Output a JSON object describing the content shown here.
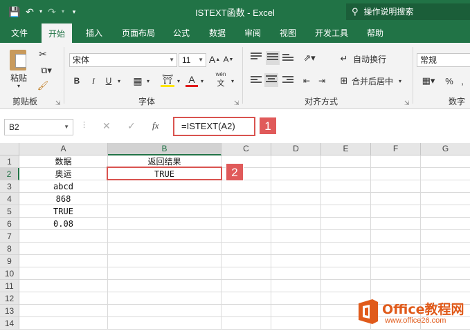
{
  "window": {
    "title": "ISTEXT函数  -  Excel",
    "tell_me": "操作说明搜索"
  },
  "tabs": [
    "文件",
    "开始",
    "插入",
    "页面布局",
    "公式",
    "数据",
    "审阅",
    "视图",
    "开发工具",
    "帮助"
  ],
  "active_tab": "开始",
  "ribbon": {
    "clipboard": {
      "paste_label": "粘贴",
      "group_label": "剪贴板"
    },
    "font": {
      "font_name": "宋体",
      "font_size": "11",
      "grow": "A",
      "shrink": "A",
      "bold": "B",
      "italic": "I",
      "underline": "U",
      "font_color": "A",
      "phonetic": "wén",
      "group_label": "字体"
    },
    "alignment": {
      "wrap_label": "自动换行",
      "merge_label": "合并后居中",
      "group_label": "对齐方式"
    },
    "number": {
      "format": "常规",
      "percent": "%",
      "group_label": "数字"
    }
  },
  "formula_bar": {
    "name_box": "B2",
    "fx": "fx",
    "formula": "=ISTEXT(A2)"
  },
  "annotations": [
    "1",
    "2"
  ],
  "columns": [
    "A",
    "B",
    "C",
    "D",
    "E",
    "F",
    "G"
  ],
  "rows": [
    "1",
    "2",
    "3",
    "4",
    "5",
    "6",
    "7",
    "8",
    "9",
    "10",
    "11",
    "12",
    "13",
    "14"
  ],
  "cells": {
    "A": [
      "数据",
      "奥运",
      "abcd",
      "868",
      "TRUE",
      "0.08"
    ],
    "B": [
      "返回结果",
      "TRUE"
    ]
  },
  "watermark": {
    "brand": "Office教程网",
    "url": "www.office26.com"
  },
  "colors": {
    "accent": "#217346",
    "highlight": "#d9534f",
    "watermark": "#e05a1a"
  }
}
